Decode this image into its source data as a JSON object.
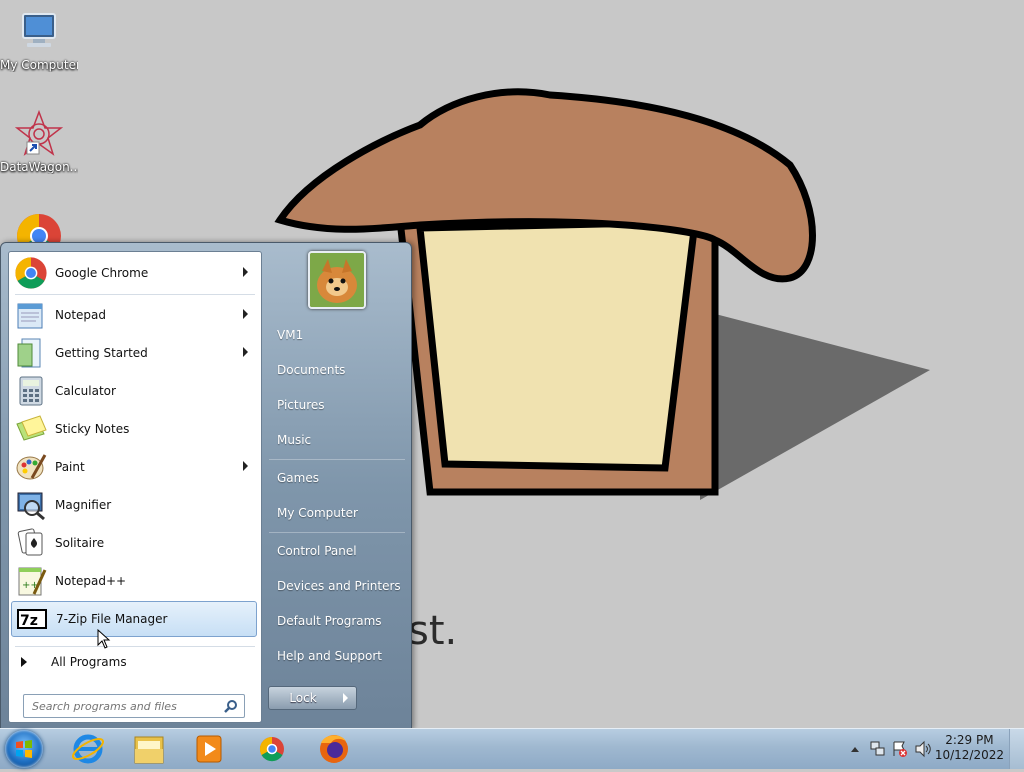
{
  "desktop": {
    "icons": [
      {
        "label": "My Computer"
      },
      {
        "label": "DataWagon..."
      }
    ],
    "wallpaper_text": "st."
  },
  "start_menu": {
    "programs": [
      {
        "label": "Google Chrome",
        "has_submenu": true
      },
      {
        "label": "Notepad",
        "has_submenu": true
      },
      {
        "label": "Getting Started",
        "has_submenu": true
      },
      {
        "label": "Calculator",
        "has_submenu": false
      },
      {
        "label": "Sticky Notes",
        "has_submenu": false
      },
      {
        "label": "Paint",
        "has_submenu": true
      },
      {
        "label": "Magnifier",
        "has_submenu": false
      },
      {
        "label": "Solitaire",
        "has_submenu": false
      },
      {
        "label": "Notepad++",
        "has_submenu": false
      },
      {
        "label": "7-Zip File Manager",
        "has_submenu": false
      }
    ],
    "all_programs": "All Programs",
    "search_placeholder": "Search programs and files",
    "right": {
      "user": "VM1",
      "documents": "Documents",
      "pictures": "Pictures",
      "music": "Music",
      "games": "Games",
      "my_computer": "My Computer",
      "control_panel": "Control Panel",
      "devices_printers": "Devices and Printers",
      "default_programs": "Default Programs",
      "help_support": "Help and Support"
    },
    "lock_label": "Lock"
  },
  "taskbar": {
    "time": "2:29 PM",
    "date": "10/12/2022"
  }
}
